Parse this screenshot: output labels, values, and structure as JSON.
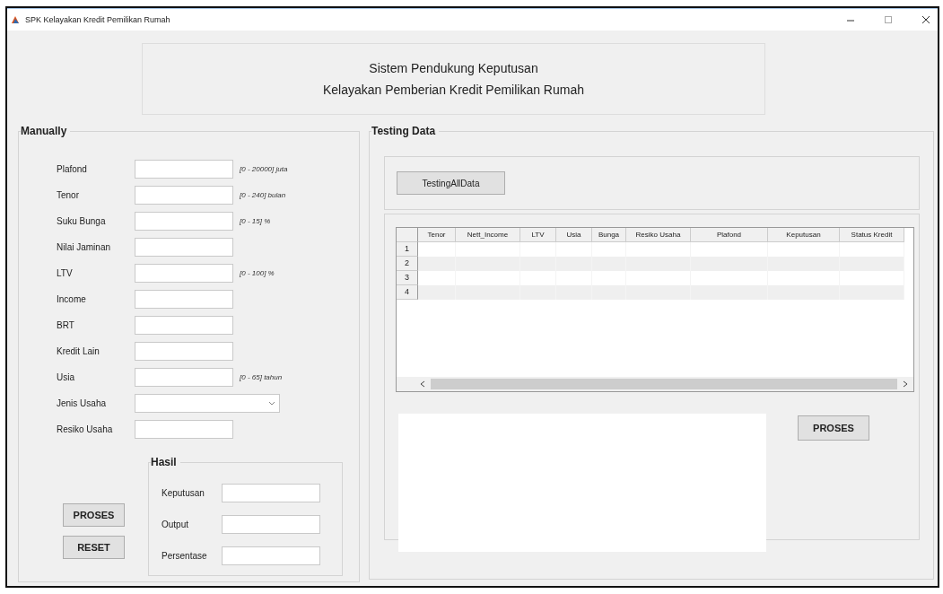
{
  "window": {
    "title": "SPK Kelayakan Kredit Pemilikan Rumah"
  },
  "header": [
    "Sistem Pendukung Keputusan",
    "Kelayakan Pemberian Kredit Pemilikan Rumah"
  ],
  "manual": {
    "title": "Manually",
    "fields": [
      {
        "label": "Plafond",
        "kind": "text",
        "hint": "[0 - 20000] juta"
      },
      {
        "label": "Tenor",
        "kind": "text",
        "hint": "[0 - 240] bulan"
      },
      {
        "label": "Suku Bunga",
        "kind": "text",
        "hint": "[0 - 15] %"
      },
      {
        "label": "Nilai Jaminan",
        "kind": "text"
      },
      {
        "label": "LTV",
        "kind": "text",
        "hint": "[0 - 100] %"
      },
      {
        "label": "Income",
        "kind": "text"
      },
      {
        "label": "BRT",
        "kind": "text"
      },
      {
        "label": "Kredit Lain",
        "kind": "text"
      },
      {
        "label": "Usia",
        "kind": "text",
        "hint": "[0 - 65] tahun"
      },
      {
        "label": "Jenis Usaha",
        "kind": "dropdown"
      },
      {
        "label": "Resiko Usaha",
        "kind": "text"
      }
    ],
    "buttons": [
      "PROSES",
      "RESET"
    ],
    "result": {
      "title": "Hasil",
      "fields": [
        "Keputusan",
        "Output",
        "Persentase"
      ]
    }
  },
  "testing": {
    "title": "Testing Data",
    "button": "TestingAllData",
    "table": {
      "columns": [
        "Tenor",
        "Nett_Income",
        "LTV",
        "Usia",
        "Bunga",
        "Resiko Usaha",
        "Plafond",
        "Keputusan",
        "Status Kredit"
      ],
      "rows": [
        "1",
        "2",
        "3",
        "4"
      ]
    },
    "button2": "PROSES"
  }
}
